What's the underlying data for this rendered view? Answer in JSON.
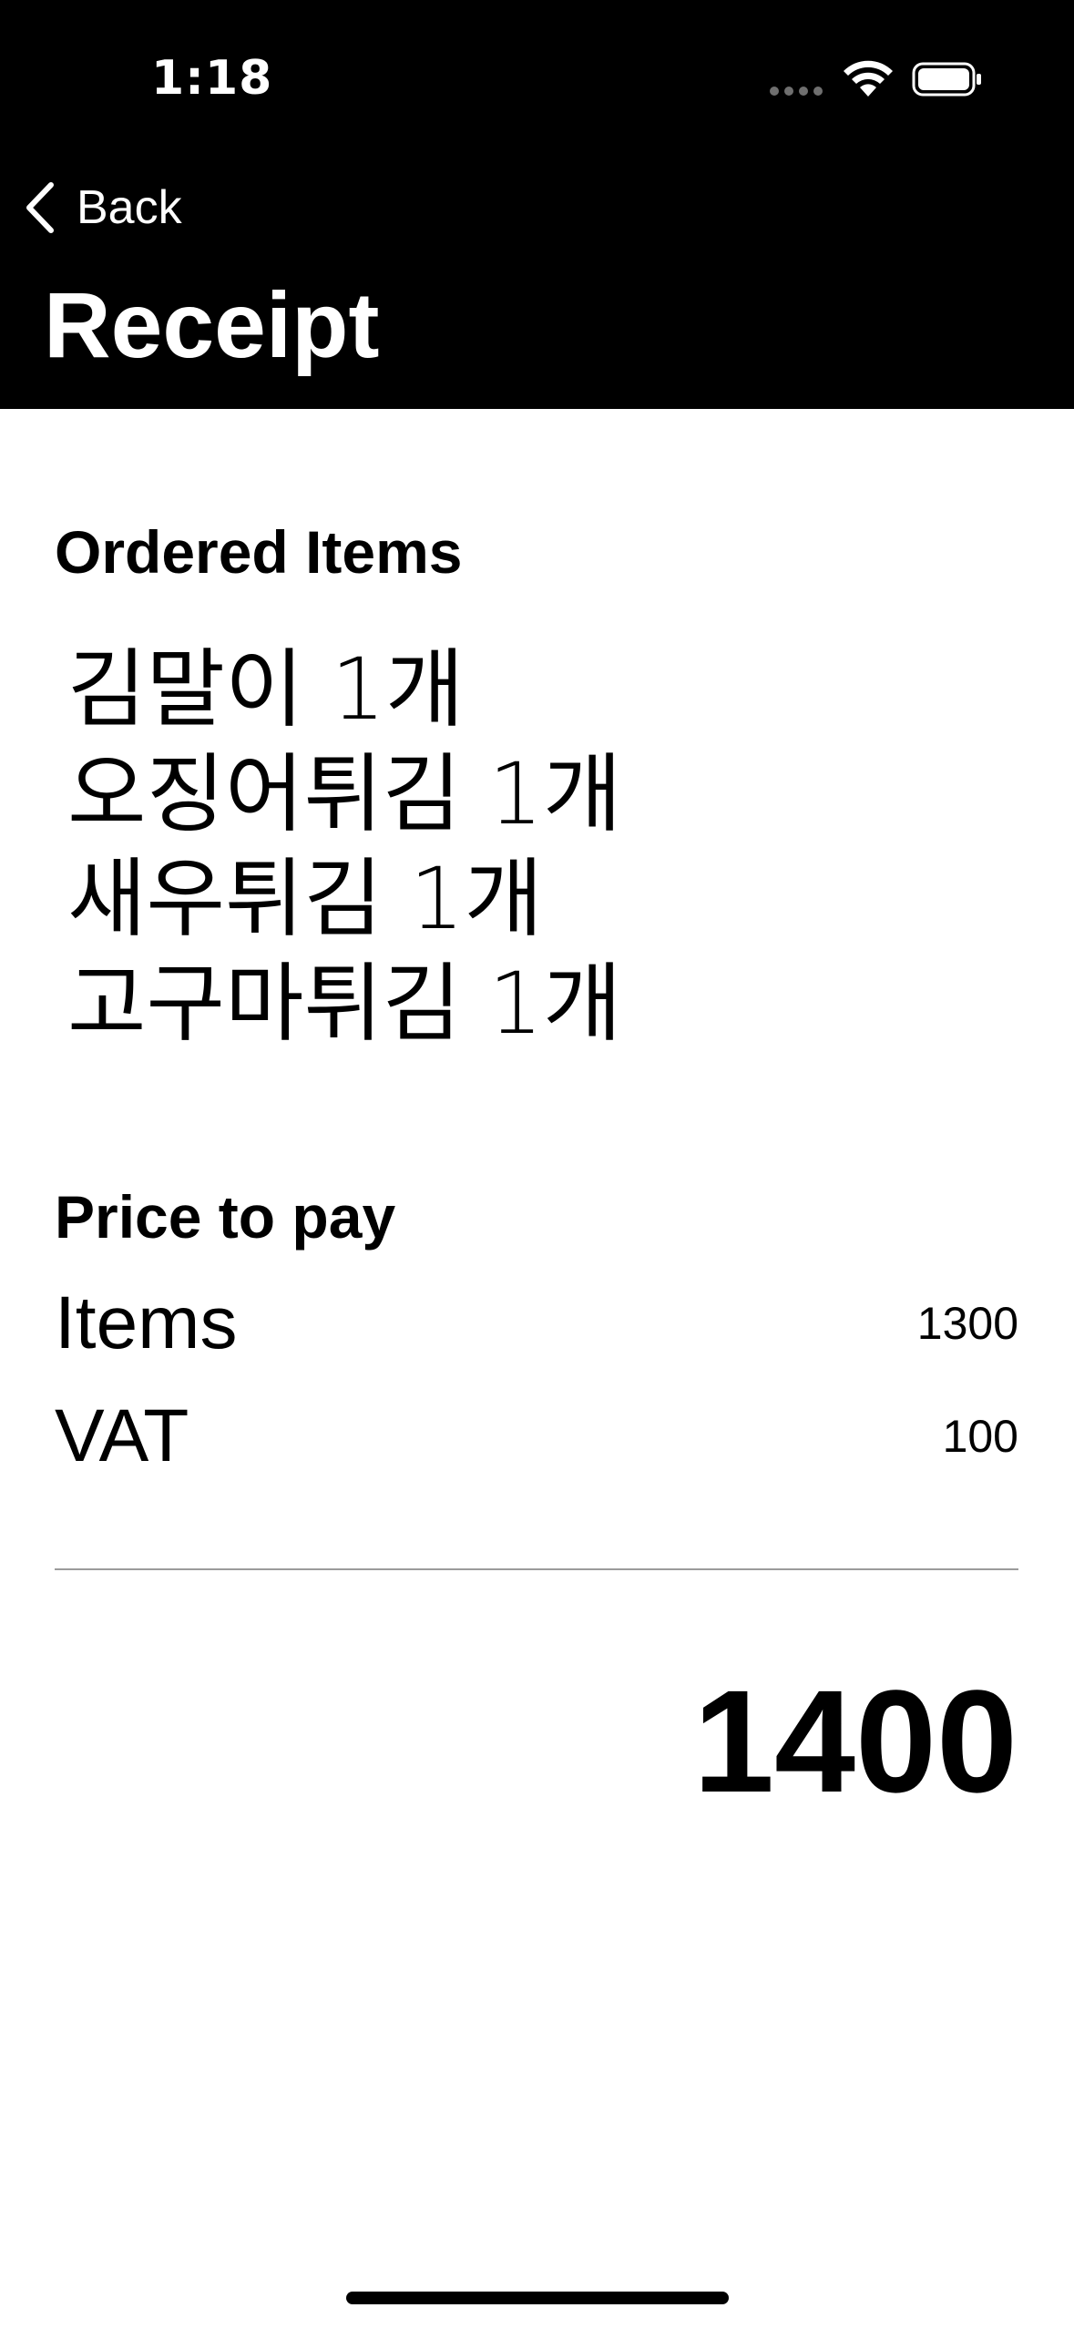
{
  "status_bar": {
    "time": "1:18"
  },
  "nav": {
    "back_label": "Back",
    "title": "Receipt"
  },
  "ordered": {
    "section_title": "Ordered Items",
    "items": [
      "김말이 1개",
      "오징어튀김 1개",
      "새우튀김 1개",
      "고구마튀김 1개"
    ]
  },
  "price": {
    "section_title": "Price to pay",
    "rows": [
      {
        "label": "Items",
        "value": "1300"
      },
      {
        "label": "VAT",
        "value": "100"
      }
    ],
    "total": "1400"
  },
  "icons": {
    "back": "chevron-left-icon",
    "wifi": "wifi-icon",
    "battery": "battery-icon",
    "signal": "signal-dots-icon"
  }
}
